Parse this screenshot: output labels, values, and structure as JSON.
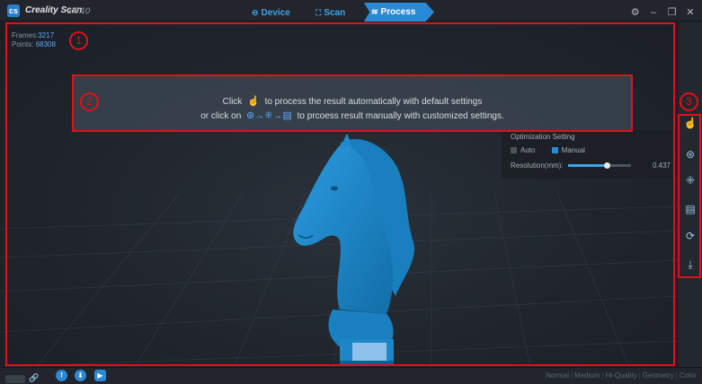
{
  "app": {
    "title": "Creality Scan",
    "version": "1.0.10",
    "logo_icon": "creality-logo-icon"
  },
  "tabs": [
    {
      "label": "Device",
      "icon": "device-icon",
      "active": false
    },
    {
      "label": "Scan",
      "icon": "scan-icon",
      "active": false
    },
    {
      "label": "Process",
      "icon": "process-icon",
      "active": true
    }
  ],
  "window_controls": {
    "settings_icon": "⚙",
    "minimize_icon": "–",
    "restore_icon": "❐",
    "close_icon": "✕"
  },
  "stats": {
    "frames_label": "Frames:",
    "frames_value": "3217",
    "points_label": "Points:",
    "points_value": "68308"
  },
  "hint": {
    "line1_prefix": "Click",
    "line1_suffix": "to process the result automatically with default settings",
    "line2_prefix": "or click on",
    "line2_suffix": "to prcoess result manually with customized settings.",
    "line2_icons": "⊛→⁜→▤"
  },
  "optimization": {
    "title": "Optimization Setting",
    "auto_label": "Auto",
    "auto_checked": false,
    "manual_label": "Manual",
    "manual_checked": true,
    "resolution_label": "Resolution(mm):",
    "resolution_value": "0.437",
    "resolution_fraction": 0.62
  },
  "right_toolbar": [
    {
      "name": "one-click-process-icon",
      "glyph": "☝"
    },
    {
      "name": "wrap-icon",
      "glyph": "⊛"
    },
    {
      "name": "mesh-icon",
      "glyph": "⁜"
    },
    {
      "name": "texture-icon",
      "glyph": "▤"
    },
    {
      "name": "refresh-icon",
      "glyph": "⟳"
    },
    {
      "name": "export-icon",
      "glyph": "⤓"
    }
  ],
  "annotations": [
    "1",
    "2",
    "3"
  ],
  "bottom": {
    "social": [
      {
        "name": "facebook-icon",
        "glyph": "f"
      },
      {
        "name": "download-icon",
        "glyph": "⬇"
      },
      {
        "name": "video-icon",
        "glyph": "▶"
      }
    ],
    "modes": [
      "Normal",
      "Medium",
      "Hi-Quality",
      "Geometry",
      "Color"
    ]
  },
  "colors": {
    "accent": "#2b8ad6",
    "annotation": "#e0101a",
    "model": "#1e88c8"
  }
}
